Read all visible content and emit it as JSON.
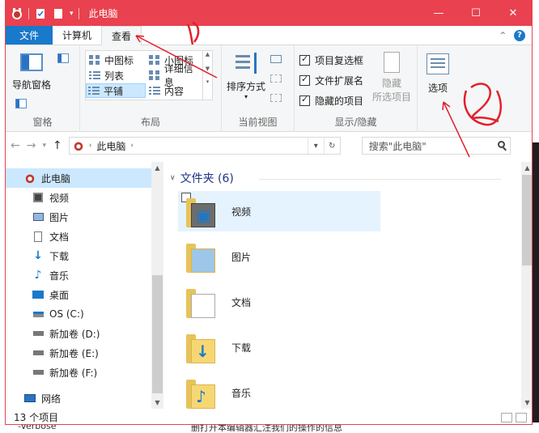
{
  "window": {
    "title": "此电脑",
    "controls": {
      "minimize": "—",
      "maximize": "☐",
      "close": "✕"
    }
  },
  "menu": {
    "file": "文件",
    "tabs": [
      "计算机",
      "查看"
    ],
    "active_tab": "查看",
    "help": "?"
  },
  "ribbon": {
    "pane": {
      "nav_pane": "导航窗格",
      "label": "窗格"
    },
    "layout": {
      "items": [
        "中图标",
        "小图标",
        "列表",
        "详细信息",
        "平铺",
        "内容"
      ],
      "selected": "平铺",
      "label": "布局"
    },
    "current_view": {
      "sort": "排序方式",
      "label": "当前视图"
    },
    "show_hide": {
      "checks": [
        {
          "label": "项目复选框",
          "checked": true
        },
        {
          "label": "文件扩展名",
          "checked": true
        },
        {
          "label": "隐藏的项目",
          "checked": true
        }
      ],
      "hide_selected": "隐藏",
      "hide_selected_2": "所选项目",
      "label": "显示/隐藏"
    },
    "options": {
      "label": "选项"
    }
  },
  "address": {
    "path": "此电脑",
    "search_placeholder": "搜索\"此电脑\""
  },
  "nav": {
    "items": [
      "此电脑",
      "视频",
      "图片",
      "文档",
      "下载",
      "音乐",
      "桌面",
      "OS (C:)",
      "新加卷 (D:)",
      "新加卷 (E:)",
      "新加卷 (F:)",
      "网络"
    ]
  },
  "main": {
    "section_title": "文件夹 (6)",
    "folders": [
      "视频",
      "图片",
      "文档",
      "下载",
      "音乐"
    ]
  },
  "status": {
    "count": "13 个项目"
  },
  "background": {
    "bottom_text": "-Verbose",
    "bottom_text_2": "删打开本编辑器汇注我们的操作的信息"
  },
  "colors": {
    "accent": "#e9414f",
    "file_tab": "#1979ca",
    "selection": "#cce8ff",
    "annotation": "#e2202c"
  }
}
